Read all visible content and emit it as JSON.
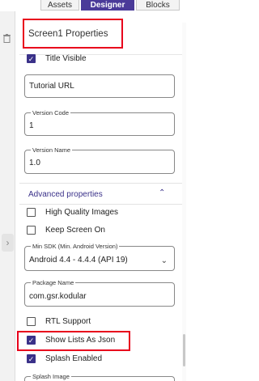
{
  "tabs": [
    {
      "label": "Assets"
    },
    {
      "label": "Designer"
    },
    {
      "label": "Blocks"
    }
  ],
  "header": {
    "title": "Screen1 Properties"
  },
  "properties": {
    "title_visible": {
      "label": "Title Visible",
      "checked": true
    },
    "tutorial_url": {
      "placeholder": "Tutorial URL",
      "value": ""
    },
    "version_code": {
      "legend": "Version Code",
      "value": "1"
    },
    "version_name": {
      "legend": "Version Name",
      "value": "1.0"
    }
  },
  "advanced": {
    "title": "Advanced properties",
    "high_quality_images": {
      "label": "High Quality Images",
      "checked": false
    },
    "keep_screen_on": {
      "label": "Keep Screen On",
      "checked": false
    },
    "min_sdk": {
      "legend": "Min SDK (Min. Android Version)",
      "value": "Android 4.4 - 4.4.4 (API 19)"
    },
    "package_name": {
      "legend": "Package Name",
      "value": "com.gsr.kodular"
    },
    "rtl_support": {
      "label": "RTL Support",
      "checked": false
    },
    "show_lists_as_json": {
      "label": "Show Lists As Json",
      "checked": true
    },
    "splash_enabled": {
      "label": "Splash Enabled",
      "checked": true
    },
    "splash_image": {
      "legend": "Splash Image",
      "value": ""
    }
  },
  "colors": {
    "accent": "#4a3a99",
    "highlight": "#e8001c"
  }
}
